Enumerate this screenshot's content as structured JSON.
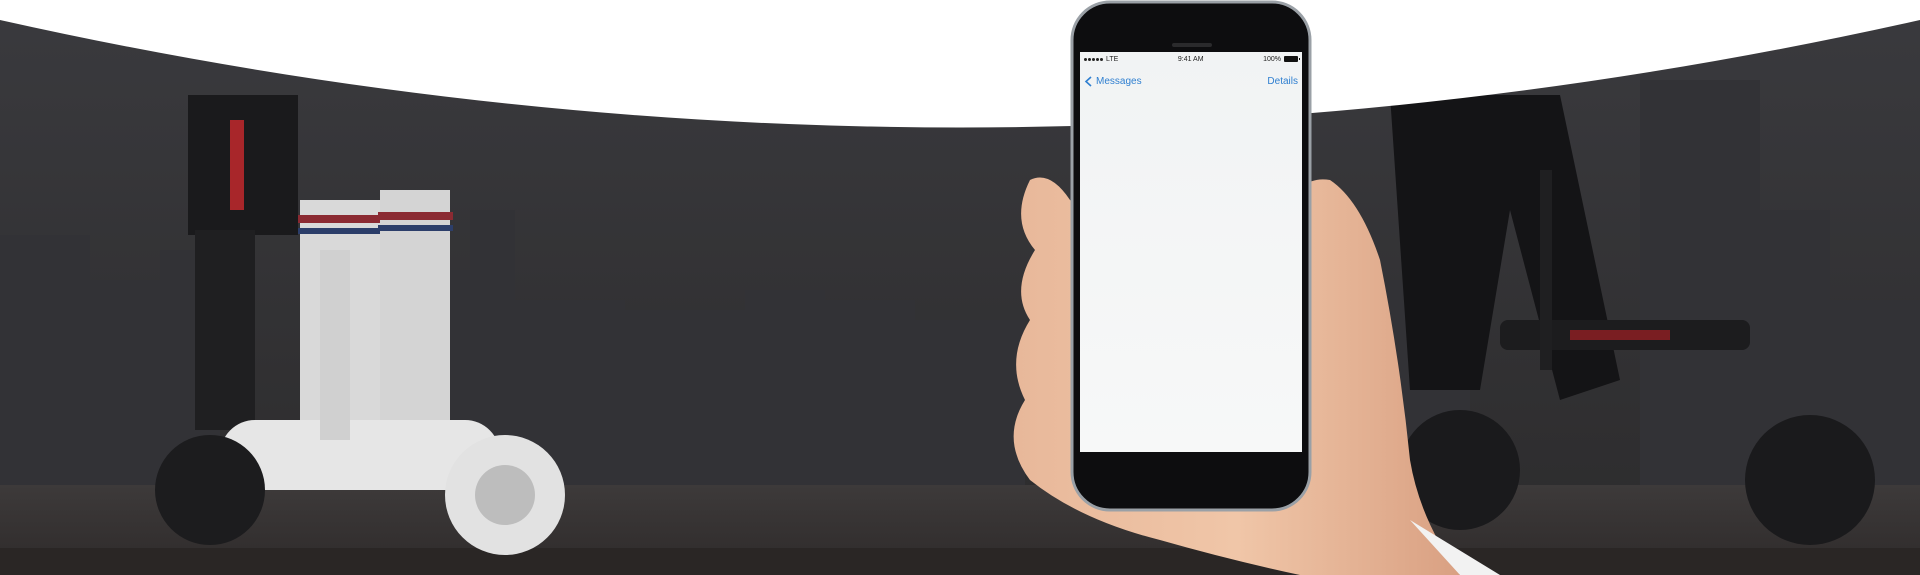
{
  "status_bar": {
    "carrier": "LTE",
    "time": "9:41 AM",
    "battery_percent": "100%"
  },
  "nav": {
    "back_label": "Messages",
    "details_label": "Details"
  },
  "icons": {
    "back": "chevron-left-icon",
    "signal": "signal-dots-icon",
    "battery": "battery-icon"
  },
  "colors": {
    "link": "#2f7fd0",
    "background": "#2a2a2d",
    "top_curve": "#ffffff"
  }
}
